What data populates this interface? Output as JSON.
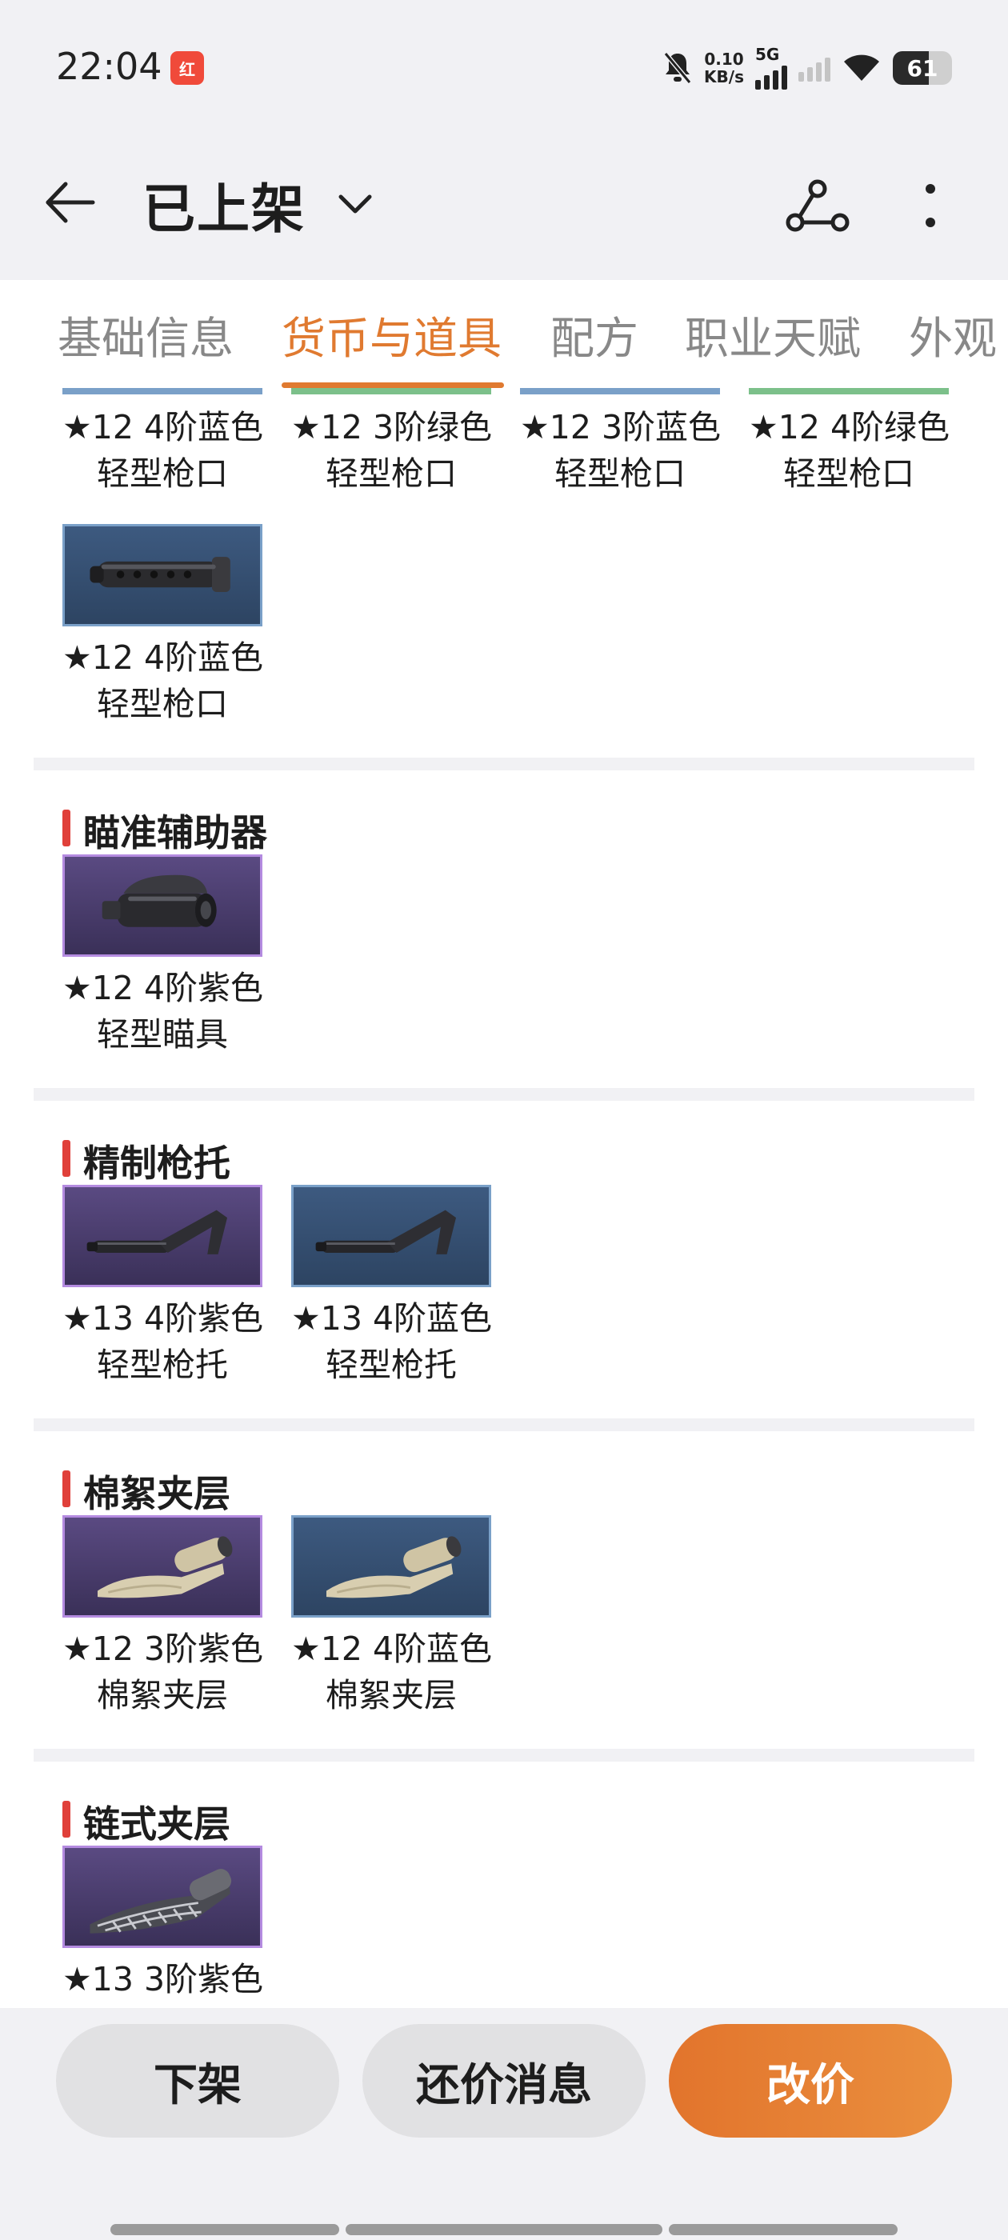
{
  "status_bar": {
    "time": "22:04",
    "app_badge": "红",
    "net_speed_value": "0.10",
    "net_speed_unit": "KB/s",
    "network": "5G",
    "battery": "61"
  },
  "header": {
    "title": "已上架"
  },
  "tabs": [
    {
      "label": "基础信息",
      "active": false
    },
    {
      "label": "货币与道具",
      "active": true
    },
    {
      "label": "配方",
      "active": false
    },
    {
      "label": "职业天赋",
      "active": false
    },
    {
      "label": "外观",
      "active": false
    }
  ],
  "top_partial_items": [
    {
      "line1": "★12 4阶蓝色",
      "line2": "轻型枪口",
      "color": "blue"
    },
    {
      "line1": "★12 3阶绿色",
      "line2": "轻型枪口",
      "color": "green"
    },
    {
      "line1": "★12 3阶蓝色",
      "line2": "轻型枪口",
      "color": "blue"
    },
    {
      "line1": "★12 4阶绿色",
      "line2": "轻型枪口",
      "color": "green"
    },
    {
      "line1": "★12 4阶蓝色",
      "line2": "轻型枪口",
      "color": "blue",
      "icon": "muzzle-icon"
    }
  ],
  "sections": [
    {
      "title": "瞄准辅助器",
      "items": [
        {
          "line1": "★12 4阶紫色",
          "line2": "轻型瞄具",
          "color": "purple",
          "icon": "scope-icon"
        }
      ]
    },
    {
      "title": "精制枪托",
      "items": [
        {
          "line1": "★13 4阶紫色",
          "line2": "轻型枪托",
          "color": "purple",
          "icon": "stock-icon"
        },
        {
          "line1": "★13 4阶蓝色",
          "line2": "轻型枪托",
          "color": "blue",
          "icon": "stock-icon"
        }
      ]
    },
    {
      "title": "棉絮夹层",
      "items": [
        {
          "line1": "★12 3阶紫色",
          "line2": "棉絮夹层",
          "color": "purple",
          "icon": "cloth-roll-icon"
        },
        {
          "line1": "★12 4阶蓝色",
          "line2": "棉絮夹层",
          "color": "blue",
          "icon": "cloth-roll-icon"
        }
      ]
    },
    {
      "title": "链式夹层",
      "items": [
        {
          "line1": "★13 3阶紫色",
          "line2": "",
          "color": "purple",
          "icon": "chain-mesh-icon"
        }
      ]
    }
  ],
  "actions": {
    "delist": "下架",
    "counter_offer": "还价消息",
    "change_price": "改价"
  },
  "colors": {
    "accent": "#e07a30",
    "section_marker": "#e0403a",
    "rarity_blue": "#7aa0c8",
    "rarity_purple": "#b48be0",
    "rarity_green": "#7cc08a"
  }
}
